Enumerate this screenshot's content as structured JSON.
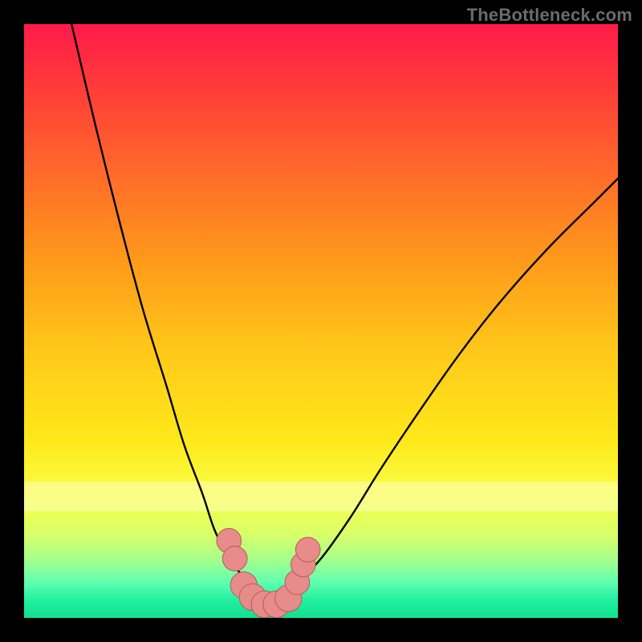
{
  "watermark": {
    "text": "TheBottleneck.com"
  },
  "colors": {
    "curve": "#000000",
    "marker_fill": "#e88b8b",
    "marker_stroke": "#b65a5a",
    "frame_bg": "#000000"
  },
  "chart_data": {
    "type": "line",
    "title": "",
    "xlabel": "",
    "ylabel": "",
    "xlim": [
      0,
      100
    ],
    "ylim": [
      0,
      100
    ],
    "grid": false,
    "series": [
      {
        "name": "left-curve",
        "x": [
          8,
          12,
          16,
          20,
          24,
          27,
          30,
          32,
          34,
          36,
          38
        ],
        "y": [
          100,
          83,
          67,
          52,
          39,
          29,
          21,
          15,
          11,
          8,
          6
        ]
      },
      {
        "name": "valley",
        "x": [
          38,
          40,
          42,
          44,
          46
        ],
        "y": [
          6,
          3,
          2,
          3,
          6
        ]
      },
      {
        "name": "right-curve",
        "x": [
          46,
          50,
          55,
          60,
          66,
          73,
          80,
          88,
          96,
          100
        ],
        "y": [
          6,
          10,
          17,
          25,
          34,
          44,
          53,
          62,
          70,
          74
        ]
      }
    ],
    "markers": [
      {
        "x": 34.5,
        "y": 13,
        "r": 1.4
      },
      {
        "x": 35.5,
        "y": 10,
        "r": 1.4
      },
      {
        "x": 37.0,
        "y": 5.5,
        "r": 1.6
      },
      {
        "x": 38.5,
        "y": 3.5,
        "r": 1.6
      },
      {
        "x": 40.5,
        "y": 2.3,
        "r": 1.6
      },
      {
        "x": 42.5,
        "y": 2.3,
        "r": 1.6
      },
      {
        "x": 44.5,
        "y": 3.3,
        "r": 1.6
      },
      {
        "x": 46.0,
        "y": 6.0,
        "r": 1.4
      },
      {
        "x": 47.0,
        "y": 9.0,
        "r": 1.4
      },
      {
        "x": 47.8,
        "y": 11.5,
        "r": 1.4
      }
    ],
    "white_band": {
      "from_y": 18,
      "to_y": 23
    }
  }
}
